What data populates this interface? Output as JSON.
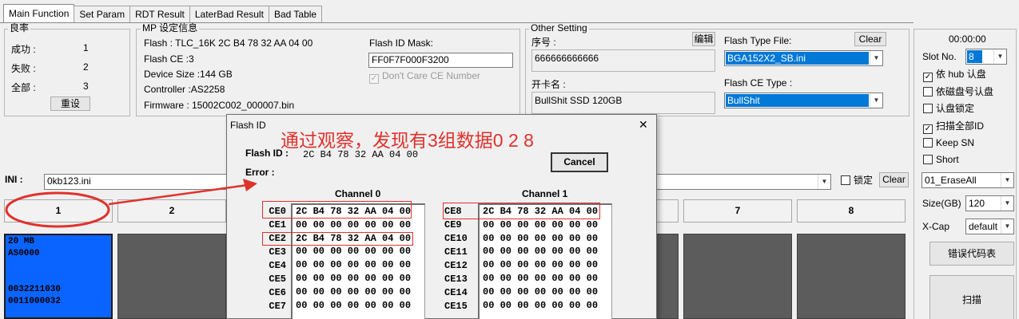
{
  "tabs": [
    "Main Function",
    "Set Param",
    "RDT Result",
    "LaterBad Result",
    "Bad Table"
  ],
  "yield": {
    "title": "良率",
    "success_label": "成功 :",
    "success_value": "1",
    "fail_label": "失败 :",
    "fail_value": "2",
    "total_label": "全部 :",
    "total_value": "3",
    "reset_button": "重设"
  },
  "mp_info": {
    "title": "MP 设定信息",
    "flash": "Flash : TLC_16K 2C B4 78 32 AA 04 00",
    "flash_ce": "Flash CE :3",
    "device_size": "Device Size :144 GB",
    "controller": "Controller :AS2258",
    "firmware": "Firmware : 15002C002_000007.bin",
    "flash_id_mask_label": "Flash ID Mask:",
    "flash_id_mask_value": "FF0F7F000F3200",
    "dont_care_ce": "Don't Care CE Number"
  },
  "other_setting": {
    "title": "Other Setting",
    "serial_label": "序号 :",
    "edit_button": "编辑",
    "serial_value": "666666666666",
    "card_name_label": "开卡名 :",
    "card_name_value": "BullShit SSD 120GB",
    "flash_type_label": "Flash Type File:",
    "clear_button": "Clear",
    "flash_type_value": "BGA152X2_SB.ini",
    "flash_ce_type_label": "Flash CE Type :",
    "flash_ce_type_value": "BullShit"
  },
  "right_panel": {
    "timer": "00:00:00",
    "slot_no_label": "Slot No.",
    "slot_no_value": "8",
    "opt_hub": "依 hub 认盘",
    "opt_disk_no": "依磁盘号认盘",
    "opt_lock": "认盘锁定",
    "opt_scan_all": "扫描全部ID",
    "opt_keep_sn": "Keep SN",
    "opt_short": "Short",
    "mode_value": "01_EraseAll",
    "size_label": "Size(GB)",
    "size_value": "120",
    "xcap_label": "X-Cap",
    "xcap_value": "default",
    "error_code_button": "错误代码表",
    "scan_button": "扫描"
  },
  "ini": {
    "label": "INI :",
    "value": "0kb123.ini",
    "lock_label": "锁定",
    "clear_button": "Clear"
  },
  "slots": {
    "headers": [
      "1",
      "2",
      "7",
      "8"
    ],
    "slot1_lines": [
      "20 MB",
      "AS0000",
      "",
      "",
      "0032211030",
      "0011000032"
    ]
  },
  "dialog": {
    "title": "Flash ID",
    "close": "✕",
    "annotation": "通过观察，发现有3组数据0 2 8",
    "flash_id_label": "Flash ID :",
    "flash_id_value": "2C B4 78 32 AA 04 00",
    "error_label": "Error :",
    "cancel_button": "Cancel",
    "channel0_title": "Channel 0",
    "channel1_title": "Channel 1",
    "channel0_labels": [
      "CE0",
      "CE1",
      "CE2",
      "CE3",
      "CE4",
      "CE5",
      "CE6",
      "CE7"
    ],
    "channel0_values": [
      "2C B4 78 32 AA 04 00",
      "00 00 00 00 00 00 00",
      "2C B4 78 32 AA 04 00",
      "00 00 00 00 00 00 00",
      "00 00 00 00 00 00 00",
      "00 00 00 00 00 00 00",
      "00 00 00 00 00 00 00",
      "00 00 00 00 00 00 00"
    ],
    "channel1_labels": [
      "CE8",
      "CE9",
      "CE10",
      "CE11",
      "CE12",
      "CE13",
      "CE14",
      "CE15"
    ],
    "channel1_values": [
      "2C B4 78 32 AA 04 00",
      "00 00 00 00 00 00 00",
      "00 00 00 00 00 00 00",
      "00 00 00 00 00 00 00",
      "00 00 00 00 00 00 00",
      "00 00 00 00 00 00 00",
      "00 00 00 00 00 00 00",
      "00 00 00 00 00 00 00"
    ]
  },
  "colors": {
    "annotation_red": "#e0322c",
    "slot_active_blue": "#0a64ff",
    "selection_blue": "#0078d7"
  }
}
